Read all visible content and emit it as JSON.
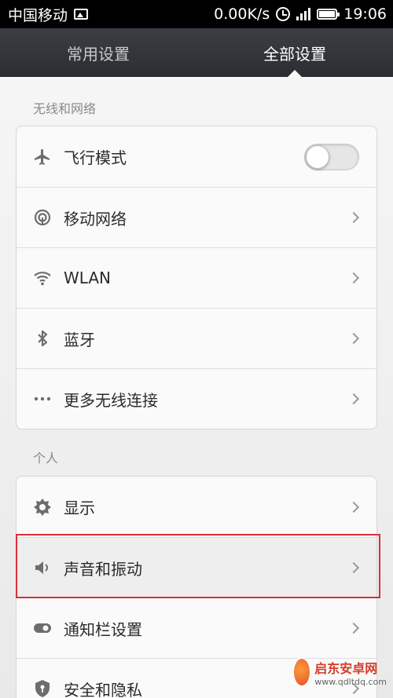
{
  "status_bar": {
    "carrier": "中国移动",
    "speed": "0.00K/s",
    "time": "19:06"
  },
  "tabs": [
    {
      "label": "常用设置",
      "active": false
    },
    {
      "label": "全部设置",
      "active": true
    }
  ],
  "sections": [
    {
      "header": "无线和网络",
      "items": [
        {
          "icon": "airplane-icon",
          "label": "飞行模式",
          "control": "toggle",
          "toggle_on": false
        },
        {
          "icon": "mobile-network-icon",
          "label": "移动网络",
          "control": "chevron"
        },
        {
          "icon": "wifi-icon",
          "label": "WLAN",
          "control": "chevron"
        },
        {
          "icon": "bluetooth-icon",
          "label": "蓝牙",
          "control": "chevron"
        },
        {
          "icon": "more-icon",
          "label": "更多无线连接",
          "control": "chevron"
        }
      ]
    },
    {
      "header": "个人",
      "items": [
        {
          "icon": "display-icon",
          "label": "显示",
          "control": "chevron"
        },
        {
          "icon": "sound-icon",
          "label": "声音和振动",
          "control": "chevron",
          "highlighted": true
        },
        {
          "icon": "notification-bar-icon",
          "label": "通知栏设置",
          "control": "chevron"
        },
        {
          "icon": "shield-icon",
          "label": "安全和隐私",
          "control": "chevron"
        }
      ]
    }
  ],
  "watermark": {
    "title": "启东安卓网",
    "url": "www.qdltdq.com"
  },
  "colors": {
    "highlight_border": "#d9303a",
    "tabbar_bg": "#2f3236"
  }
}
